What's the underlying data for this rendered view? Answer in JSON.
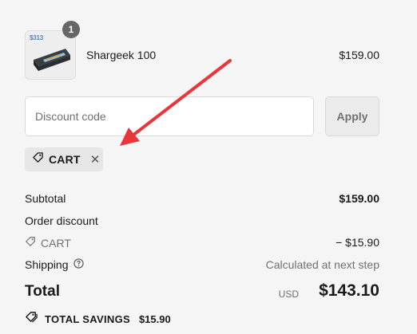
{
  "cart": {
    "item": {
      "name": "Shargeek 100",
      "price": "$159.00",
      "quantity": "1",
      "thumb_text": "$313"
    }
  },
  "discount": {
    "placeholder": "Discount code",
    "apply_label": "Apply",
    "applied_code": "CART"
  },
  "summary": {
    "subtotal_label": "Subtotal",
    "subtotal_value": "$159.00",
    "order_discount_label": "Order discount",
    "discount_code": "CART",
    "discount_value": "− $15.90",
    "shipping_label": "Shipping",
    "shipping_value": "Calculated at next step",
    "total_label": "Total",
    "total_currency": "USD",
    "total_value": "$143.10",
    "savings_label": "TOTAL SAVINGS",
    "savings_value": "$15.90"
  },
  "colors": {
    "arrow": "#e8363a",
    "background": "#f5f5f5"
  },
  "icons": [
    "tag-icon",
    "close-icon",
    "help-circle-icon",
    "savings-tag-icon"
  ]
}
